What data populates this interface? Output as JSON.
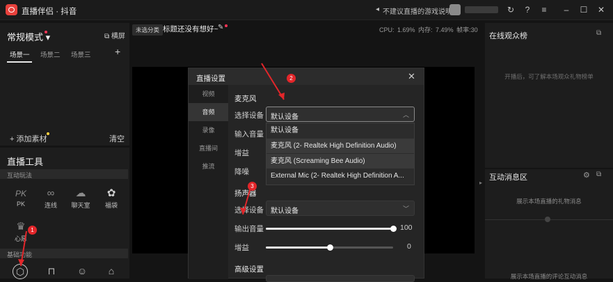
{
  "titlebar": {
    "app_title": "直播伴侣 · 抖音",
    "notice": "不建议直播的游戏说明",
    "icons": [
      "refresh-icon",
      "help-icon",
      "menu-icon",
      "minimize-icon",
      "maximize-icon",
      "close-icon"
    ]
  },
  "left": {
    "mode_title": "常规模式",
    "landscape_label": "横屏",
    "scenes": [
      "场景一",
      "场景二",
      "场景三"
    ],
    "add_scene": "+",
    "add_material": "+ 添加素材",
    "clear_label": "清空"
  },
  "tools": {
    "title": "直播工具",
    "interactive_label": "互动玩法",
    "items": [
      {
        "icon": "PK",
        "label": "PK"
      },
      {
        "icon": "∞",
        "label": "连线"
      },
      {
        "icon": "☁",
        "label": "聊天室"
      },
      {
        "icon": "✿",
        "label": "福袋"
      },
      {
        "icon": "♛",
        "label": "心愿"
      }
    ],
    "basic_label": "基础功能"
  },
  "center": {
    "uncategorized": "未选分类",
    "stream_title": "标题还没有想好~",
    "cpu": "CPU: 1.69%",
    "memory": "内存: 7.49%",
    "fps": "帧率:30"
  },
  "audience": {
    "title": "在线观众榜",
    "empty_text": "开播后，可了解本场观众礼物榜单"
  },
  "messages": {
    "title": "互动消息区",
    "gift_empty": "展示本场直播的礼物消息",
    "comment_empty": "展示本场直播的评论互动消息"
  },
  "dialog": {
    "title": "直播设置",
    "nav": [
      "视频",
      "音频",
      "录像",
      "直播间",
      "推流"
    ],
    "mic_section": "麦克风",
    "select_device_label": "选择设备",
    "mic_selected": "默认设备",
    "mic_options": [
      "默认设备",
      "麦克风 (2- Realtek High Definition Audio)",
      "麦克风 (Screaming Bee Audio)",
      "External Mic (2- Realtek High Definition A..."
    ],
    "input_volume_label": "输入音量",
    "gain_label": "增益",
    "noise_label": "降噪",
    "speaker_section": "扬声器",
    "speaker_select_label": "选择设备",
    "speaker_selected": "默认设备",
    "output_volume_label": "输出音量",
    "output_volume": 100,
    "speaker_gain_label": "增益",
    "speaker_gain": 0,
    "advanced_label": "高级设置"
  },
  "annotations": {
    "b1": "1",
    "b2": "2",
    "b3": "3"
  },
  "colors": {
    "accent": "#e3262a",
    "dot": "#ff3355"
  }
}
